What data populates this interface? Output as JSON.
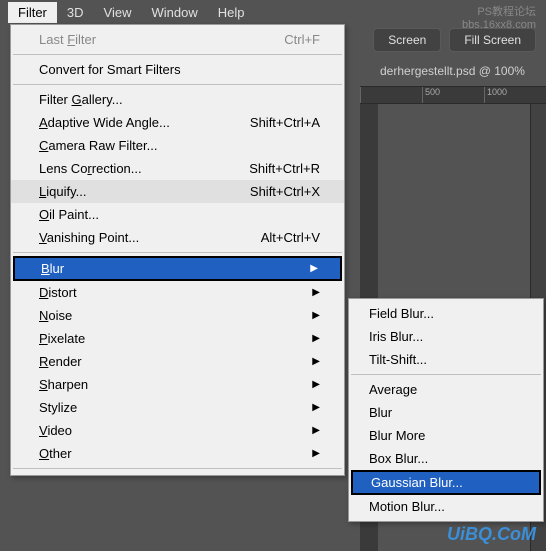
{
  "menubar": {
    "items": [
      "Filter",
      "3D",
      "View",
      "Window",
      "Help"
    ]
  },
  "toolbar": {
    "screen_btn": "Screen",
    "fill_screen_btn": "Fill Screen"
  },
  "document": {
    "title": "derhergestellt.psd @ 100%",
    "ruler_marks": [
      "",
      "500",
      "1000"
    ]
  },
  "filter_menu": {
    "last_filter": {
      "label_pre": "Last ",
      "label_u": "F",
      "label_post": "ilter",
      "shortcut": "Ctrl+F"
    },
    "convert_smart": {
      "label": "Convert for Smart Filters"
    },
    "filter_gallery": {
      "label_pre": "Filter ",
      "label_u": "G",
      "label_post": "allery..."
    },
    "adaptive": {
      "label_u": "A",
      "label_post": "daptive Wide Angle...",
      "shortcut": "Shift+Ctrl+A"
    },
    "camera_raw": {
      "label_u": "C",
      "label_post": "amera Raw Filter..."
    },
    "lens": {
      "label_pre": "Lens Co",
      "label_u": "r",
      "label_post": "rection...",
      "shortcut": "Shift+Ctrl+R"
    },
    "liquify": {
      "label_u": "L",
      "label_post": "iquify...",
      "shortcut": "Shift+Ctrl+X"
    },
    "oil": {
      "label_u": "O",
      "label_post": "il Paint..."
    },
    "vanishing": {
      "label_u": "V",
      "label_post": "anishing Point...",
      "shortcut": "Alt+Ctrl+V"
    },
    "blur": {
      "label_u": "B",
      "label_post": "lur"
    },
    "distort": {
      "label_u": "D",
      "label_post": "istort"
    },
    "noise": {
      "label_u": "N",
      "label_post": "oise"
    },
    "pixelate": {
      "label_u": "P",
      "label_post": "ixelate"
    },
    "render": {
      "label_u": "R",
      "label_post": "ender"
    },
    "sharpen": {
      "label_u": "S",
      "label_post": "harpen"
    },
    "stylize": {
      "label_post": "Stylize"
    },
    "video": {
      "label_u": "V",
      "label_post": "ideo"
    },
    "other": {
      "label_u": "O",
      "label_post": "ther"
    }
  },
  "blur_submenu": {
    "field_blur": "Field Blur...",
    "iris_blur": "Iris Blur...",
    "tilt_shift": "Tilt-Shift...",
    "average": "Average",
    "blur": "Blur",
    "blur_more": "Blur More",
    "box_blur": "Box Blur...",
    "gaussian": "Gaussian Blur...",
    "motion": "Motion Blur..."
  },
  "watermark": {
    "top1": "PS教程论坛",
    "top2": "bbs.16xx8.com",
    "bottom": "UiBQ.CoM"
  }
}
